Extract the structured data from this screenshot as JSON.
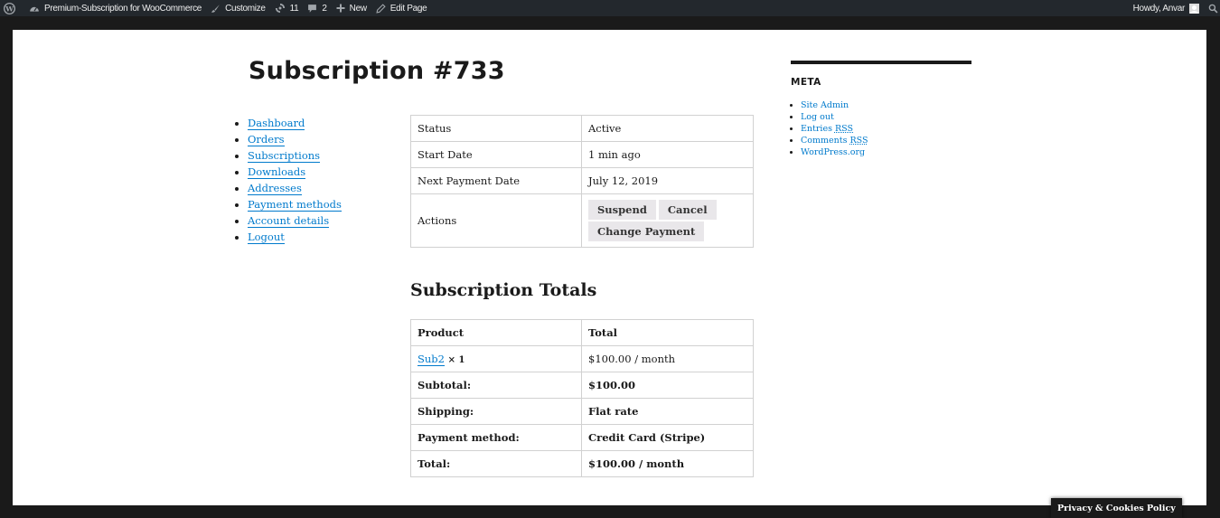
{
  "adminbar": {
    "site_name": "Premium-Subscription for WooCommerce",
    "customize": "Customize",
    "updates_count": "11",
    "comments_count": "2",
    "new_label": "New",
    "edit_page": "Edit Page",
    "howdy": "Howdy, Anvar"
  },
  "page": {
    "title": "Subscription #733"
  },
  "account_nav": [
    {
      "label": "Dashboard"
    },
    {
      "label": "Orders"
    },
    {
      "label": "Subscriptions"
    },
    {
      "label": "Downloads"
    },
    {
      "label": "Addresses"
    },
    {
      "label": "Payment methods"
    },
    {
      "label": "Account details"
    },
    {
      "label": "Logout"
    }
  ],
  "details": {
    "status_label": "Status",
    "status_value": "Active",
    "start_label": "Start Date",
    "start_value": "1 min ago",
    "next_label": "Next Payment Date",
    "next_value": "July 12, 2019",
    "actions_label": "Actions",
    "actions": {
      "suspend": "Suspend",
      "cancel": "Cancel",
      "change_payment": "Change Payment"
    }
  },
  "totals": {
    "heading": "Subscription Totals",
    "header_product": "Product",
    "header_total": "Total",
    "product_name": "Sub2",
    "product_qty": "× 1",
    "product_total": "$100.00 / month",
    "rows": [
      {
        "label": "Subtotal:",
        "value": "$100.00"
      },
      {
        "label": "Shipping:",
        "value": "Flat rate"
      },
      {
        "label": "Payment method:",
        "value": "Credit Card (Stripe)"
      },
      {
        "label": "Total:",
        "value": "$100.00 / month"
      }
    ]
  },
  "sidebar": {
    "meta_title": "META",
    "site_admin": "Site Admin",
    "log_out": "Log out",
    "entries": "Entries",
    "comments": "Comments",
    "rss": "RSS",
    "wordpress_org": "WordPress.org"
  },
  "cookie_policy": "Privacy & Cookies Policy"
}
